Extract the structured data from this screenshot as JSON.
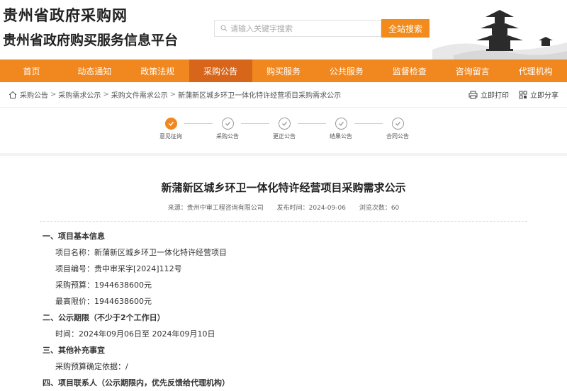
{
  "header": {
    "title": "贵州省政府采购网",
    "subtitle": "贵州省政府购买服务信息平台",
    "search_placeholder": "请输入关键字搜索",
    "search_button": "全站搜索"
  },
  "nav": [
    "首页",
    "动态通知",
    "政策法规",
    "采购公告",
    "购买服务",
    "公共服务",
    "监督检查",
    "咨询留言",
    "代理机构"
  ],
  "breadcrumb": [
    "采购公告",
    "采购需求公示",
    "采购文件需求公示",
    "新蒲新区城乡环卫一体化特许经营项目采购需求公示"
  ],
  "tools": {
    "print": "立即打印",
    "share": "立即分享"
  },
  "steps": [
    "意见征询",
    "采购公告",
    "更正公告",
    "结果公告",
    "合同公告"
  ],
  "article": {
    "title": "新蒲新区城乡环卫一体化特许经营项目采购需求公示",
    "source": "来源：贵州中审工程咨询有限公司",
    "date": "发布时间：2024-09-06",
    "views": "浏览次数：60",
    "s1": "一、项目基本信息",
    "l1": "项目名称：新蒲新区城乡环卫一体化特许经营项目",
    "l2": "项目编号：贵中审采字[2024]112号",
    "l3": "采购预算：1944638600元",
    "l4": "最高限价：1944638600元",
    "s2": "二、公示期限（不少于2个工作日）",
    "l5": "时间：2024年09月06日至 2024年09月10日",
    "s3": "三、其他补充事宜",
    "l6": "采购预算确定依据：/",
    "s4": "四、项目联系人（公示期限内，优先反馈给代理机构）"
  },
  "colors": {
    "accent": "#f0871f",
    "active": "#d7661a"
  }
}
